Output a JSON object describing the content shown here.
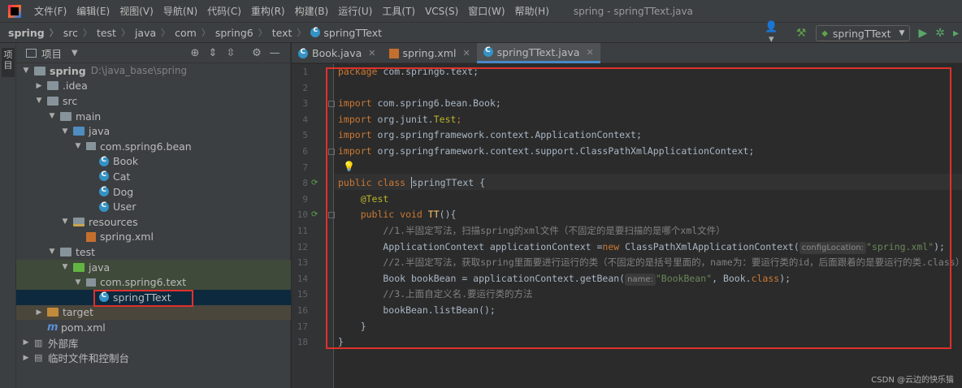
{
  "menubar": {
    "items": [
      "文件(F)",
      "编辑(E)",
      "视图(V)",
      "导航(N)",
      "代码(C)",
      "重构(R)",
      "构建(B)",
      "运行(U)",
      "工具(T)",
      "VCS(S)",
      "窗口(W)",
      "帮助(H)"
    ],
    "window_title": "spring - springTText.java"
  },
  "breadcrumb": [
    "spring",
    "src",
    "test",
    "java",
    "com",
    "spring6",
    "text",
    "springTText"
  ],
  "toolbar": {
    "run_config": "springTText"
  },
  "project_panel": {
    "title": "项目",
    "tool_stripe_label": "项目",
    "tree": [
      {
        "label": "spring",
        "sub": "D:\\java_base\\spring"
      },
      {
        "label": ".idea"
      },
      {
        "label": "src"
      },
      {
        "label": "main"
      },
      {
        "label": "java"
      },
      {
        "label": "com.spring6.bean"
      },
      {
        "label": "Book"
      },
      {
        "label": "Cat"
      },
      {
        "label": "Dog"
      },
      {
        "label": "User"
      },
      {
        "label": "resources"
      },
      {
        "label": "spring.xml"
      },
      {
        "label": "test"
      },
      {
        "label": "java"
      },
      {
        "label": "com.spring6.text"
      },
      {
        "label": "springTText"
      },
      {
        "label": "target"
      },
      {
        "label": "pom.xml"
      },
      {
        "label": "外部库"
      },
      {
        "label": "临时文件和控制台"
      }
    ]
  },
  "editor": {
    "tabs": [
      {
        "label": "Book.java"
      },
      {
        "label": "spring.xml"
      },
      {
        "label": "springTText.java"
      }
    ],
    "line_numbers": [
      "1",
      "2",
      "3",
      "4",
      "5",
      "6",
      "7",
      "8",
      "9",
      "10",
      "11",
      "12",
      "13",
      "14",
      "15",
      "16",
      "17",
      "18"
    ],
    "code": {
      "l1_kw": "package",
      "l1_rest": " com.spring6.text;",
      "l3_kw": "import",
      "l3_rest": " com.spring6.bean.Book;",
      "l4_kw": "import",
      "l4_a": " org.junit.",
      "l4_test": "Test",
      "l4_semi": ";",
      "l5_kw": "import",
      "l5_rest": " org.springframework.context.ApplicationContext;",
      "l6_kw": "import",
      "l6_rest": " org.springframework.context.support.ClassPathXmlApplicationContext;",
      "l8_kw": "public class ",
      "l8_name": "springTText",
      "l8_rest": " {",
      "l9_ann": "    @Test",
      "l10_kw": "    public void ",
      "l10_fn": "TT",
      "l10_rest": "(){",
      "l11_cmt": "        //1.半固定写法，扫描spring的xml文件（不固定的是要扫描的是哪个xml文件）",
      "l12_a": "        ApplicationContext applicationContext =",
      "l12_new": "new",
      "l12_b": " ClassPathXmlApplicationContext(",
      "l12_hint": "configLocation:",
      "l12_str": "\"spring.xml\"",
      "l12_c": ");",
      "l13_cmt": "        //2.半固定写法，获取spring里面要进行运行的类（不固定的是括号里面的，name为：要运行类的id，后面跟着的是要运行的类.class）",
      "l14_a": "        Book bookBean = applicationContext.getBean(",
      "l14_hint": "name:",
      "l14_str": "\"BookBean\"",
      "l14_b": ", Book.",
      "l14_kw": "class",
      "l14_c": ");",
      "l15_cmt": "        //3.上面自定义名.要运行类的方法",
      "l16": "        bookBean.listBean();",
      "l17": "    }",
      "l18": "}"
    }
  },
  "watermark": "CSDN @云边的快乐猫",
  "colors": {
    "keyword": "#cc7832",
    "string": "#6a8759",
    "comment": "#808080",
    "annotation": "#bbb529",
    "highlight_box": "#e0312b"
  }
}
